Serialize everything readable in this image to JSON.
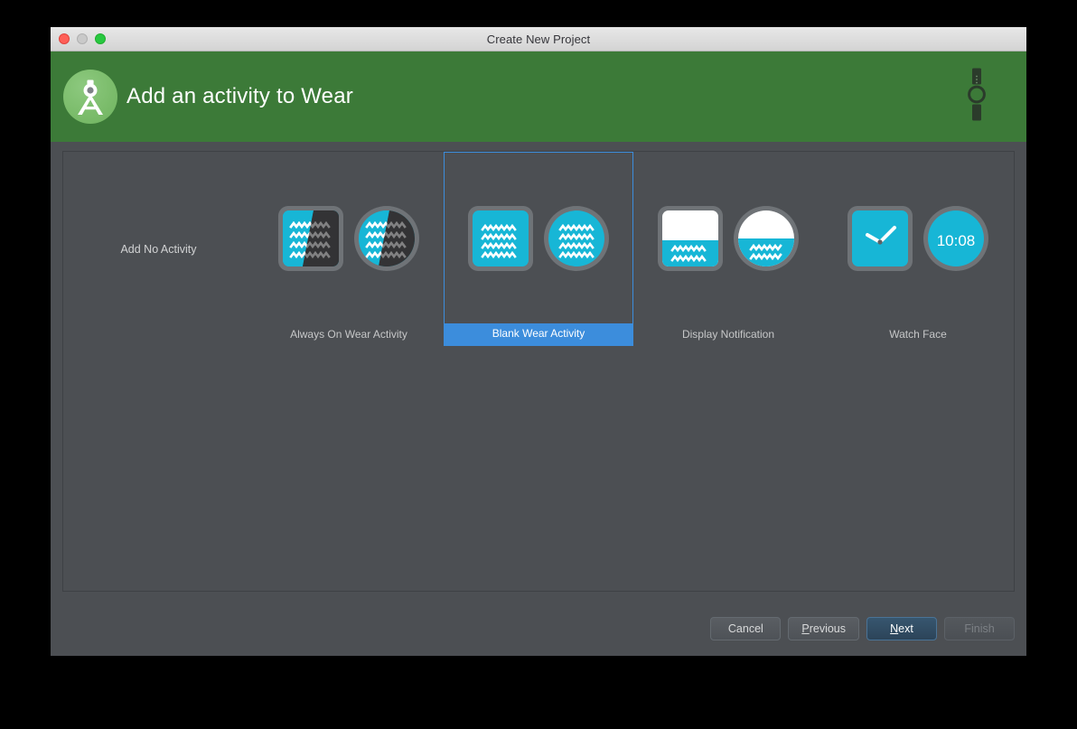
{
  "window": {
    "title": "Create New Project",
    "traffic_lights": [
      "close-red",
      "minimize-gray",
      "zoom-green"
    ]
  },
  "header": {
    "title": "Add an activity to Wear",
    "logo_icon": "android-studio-logo",
    "device_icon": "smartwatch-icon",
    "background_color": "#3c7a38"
  },
  "colors": {
    "accent_cyan": "#17b6d6",
    "selection_blue": "#3c8ddc",
    "panel_bg": "#4c4f53",
    "thumb_frame": "#6f7377",
    "dark_face": "#333335"
  },
  "main": {
    "no_activity": {
      "label": "Add No Activity"
    },
    "templates": [
      {
        "label": "Always On Wear Activity",
        "selected": false,
        "art": "split-diagonal-cyan-dark",
        "rows": 4
      },
      {
        "label": "Blank Wear Activity",
        "selected": true,
        "art": "solid-cyan-text",
        "rows": 4
      },
      {
        "label": "Display Notification",
        "selected": false,
        "art": "white-top-cyan-bottom",
        "rows": 2
      },
      {
        "label": "Watch Face",
        "selected": false,
        "art": "clock-face",
        "digital_time": "10:08"
      }
    ]
  },
  "footer": {
    "buttons": [
      {
        "label": "Cancel",
        "name": "cancel-button",
        "state": "normal"
      },
      {
        "label": "Previous",
        "name": "previous-button",
        "state": "normal",
        "mnemonic": "P"
      },
      {
        "label": "Next",
        "name": "next-button",
        "state": "default",
        "mnemonic": "N"
      },
      {
        "label": "Finish",
        "name": "finish-button",
        "state": "disabled"
      }
    ]
  }
}
